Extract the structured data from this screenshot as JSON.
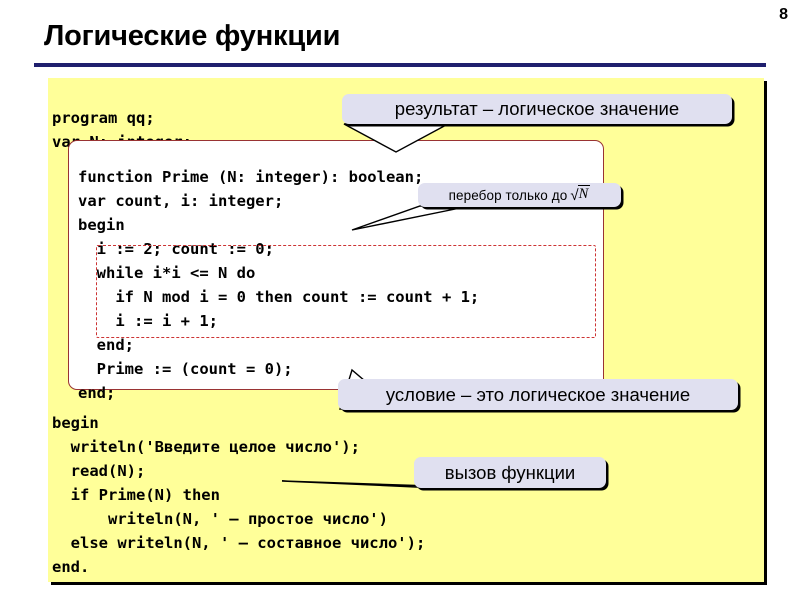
{
  "slide": {
    "number": "8",
    "title": "Логические функции",
    "rule_color": "#1f1f6e",
    "panel_color": "#ffff99",
    "callout_color": "#e0e0f0",
    "function_box_border_color": "#993333",
    "loop_box_border_color": "#cc3333"
  },
  "code": {
    "head": "program qq;\nvar N: integer;",
    "function": "function Prime (N: integer): boolean;\nvar count, i: integer;\nbegin\n  i := 2; count := 0;\n  while i*i <= N do\n    if N mod i = 0 then count := count + 1;\n    i := i + 1;\n  end;\n  Prime := (count = 0);\nend;",
    "tail": "begin\n  writeln('Введите целое число');\n  read(N);\n  if Prime(N) then\n      writeln(N, ' – простое число')\n  else writeln(N, ' – составное число');\nend."
  },
  "callouts": {
    "result": "результат – логическое значение",
    "sqrt_prefix": "перебор только до",
    "sqrt_arg": "N",
    "condition": "условие – это логическое значение",
    "call": "вызов функции"
  }
}
